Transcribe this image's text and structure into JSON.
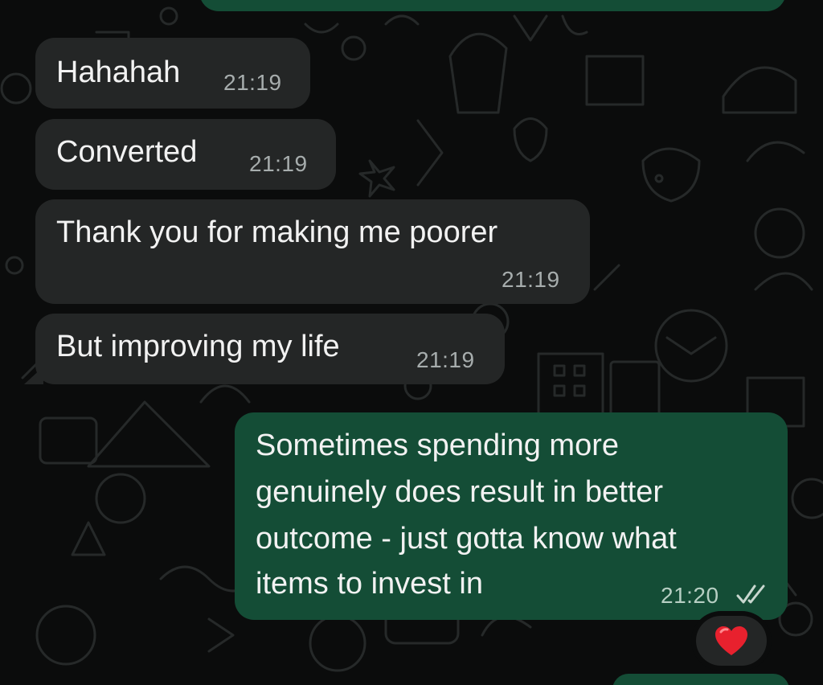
{
  "chat": {
    "wallpaper": "whatsapp-doodle-pattern",
    "colors": {
      "background": "#0b0c0c",
      "incoming_bubble": "#242626",
      "outgoing_bubble": "#144d36",
      "text": "#f2f2f2",
      "timestamp": "#a7adad",
      "read_ticks": "#c8d7cf"
    },
    "messages": [
      {
        "direction": "incoming",
        "text": "Hahahah",
        "time": "21:19"
      },
      {
        "direction": "incoming",
        "text": "Converted",
        "time": "21:19"
      },
      {
        "direction": "incoming",
        "text": "Thank you for making me poorer",
        "time": "21:19"
      },
      {
        "direction": "incoming",
        "text": "But improving my life",
        "time": "21:19"
      },
      {
        "direction": "outgoing",
        "lines": [
          "Sometimes spending more",
          "genuinely does result in better",
          "outcome - just gotta know what",
          "items to invest in"
        ],
        "time": "21:20",
        "status_icon": "double-check-icon",
        "reaction": "❤️"
      }
    ]
  }
}
